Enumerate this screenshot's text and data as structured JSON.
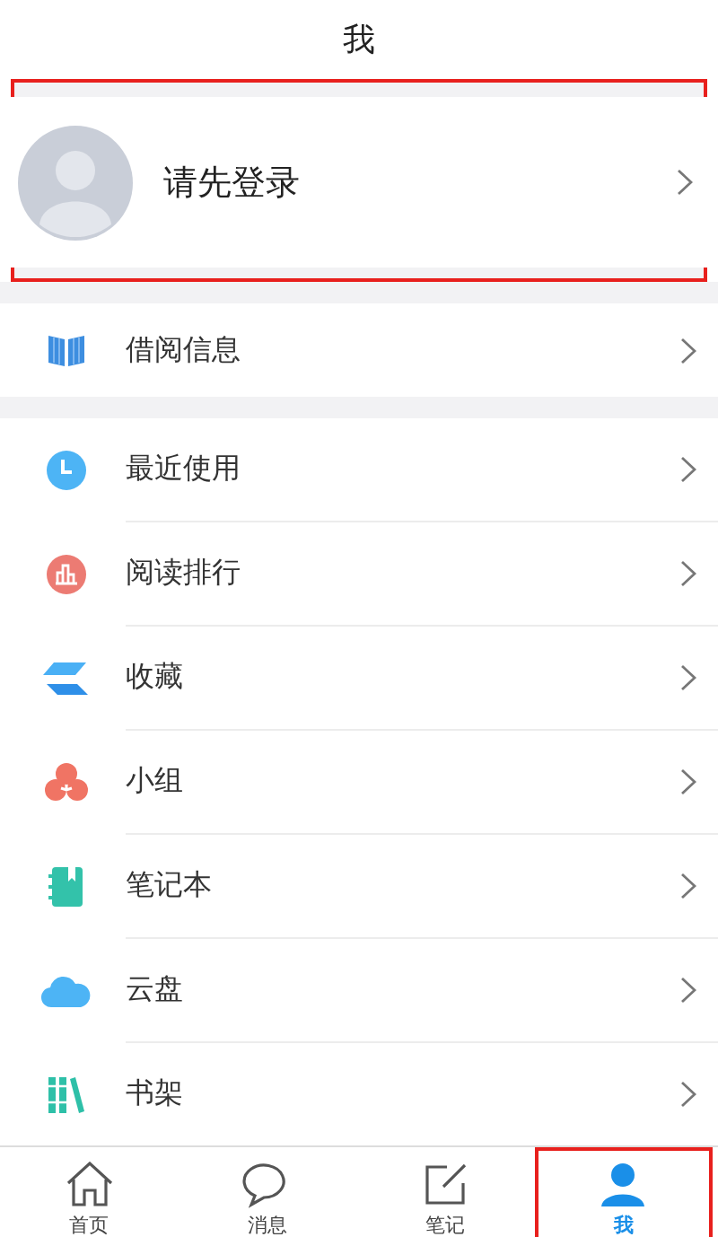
{
  "header": {
    "title": "我"
  },
  "profile": {
    "label": "请先登录",
    "highlighted": true
  },
  "sections": [
    {
      "items": [
        {
          "kind": "book",
          "label": "借阅信息"
        }
      ]
    },
    {
      "items": [
        {
          "kind": "clock",
          "label": "最近使用"
        },
        {
          "kind": "chart",
          "label": "阅读排行"
        },
        {
          "kind": "layers",
          "label": "收藏"
        },
        {
          "kind": "petals",
          "label": "小组"
        },
        {
          "kind": "notebook",
          "label": "笔记本"
        },
        {
          "kind": "cloud",
          "label": "云盘"
        },
        {
          "kind": "shelf",
          "label": "书架"
        }
      ]
    }
  ],
  "tabs": [
    {
      "kind": "home",
      "label": "首页",
      "selected": false,
      "highlighted": false
    },
    {
      "kind": "chat",
      "label": "消息",
      "selected": false,
      "highlighted": false
    },
    {
      "kind": "note",
      "label": "笔记",
      "selected": false,
      "highlighted": false
    },
    {
      "kind": "person",
      "label": "我",
      "selected": true,
      "highlighted": true
    }
  ]
}
